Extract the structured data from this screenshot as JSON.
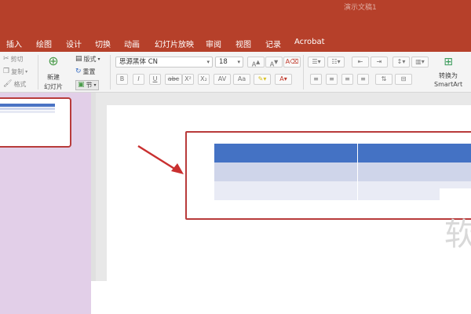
{
  "window": {
    "title": "演示文稿1"
  },
  "tabs": [
    "插入",
    "绘图",
    "设计",
    "切换",
    "动画",
    "幻灯片放映",
    "审阅",
    "视图",
    "记录",
    "Acrobat"
  ],
  "clipboard": {
    "cut": "剪切",
    "copy": "复制",
    "format": "格式"
  },
  "slides_group": {
    "new_slide_line1": "新建",
    "new_slide_line2": "幻灯片",
    "layout": "版式",
    "reset": "重置",
    "section": "节"
  },
  "font": {
    "family": "思源黑体 CN",
    "size": "18"
  },
  "format_buttons": {
    "bold": "B",
    "italic": "I",
    "underline": "U",
    "strike": "abc",
    "superscript": "X²",
    "subscript": "X₂"
  },
  "convert": {
    "line1": "转换为",
    "line2": "SmartArt"
  },
  "watermark": "软",
  "colors": {
    "brand": "#b6402a",
    "panel": "#e2cfe8",
    "table_header": "#4472c4",
    "table_row1": "#cfd5ea",
    "table_row2": "#e9ebf5",
    "highlight": "#b83b3b"
  }
}
